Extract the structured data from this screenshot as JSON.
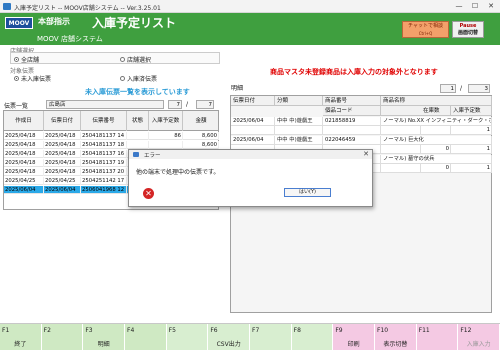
{
  "window": {
    "title": "入庫予定リスト -- MOOV店舗システム -- Ver.3.25.01",
    "min": "—",
    "max": "☐",
    "close": "✕"
  },
  "header": {
    "menu_label": "本部指示",
    "page_title": "入庫予定リスト",
    "logo": "MOOV",
    "system_name": "MOOV 店舗システム",
    "chat_label": "チャットで相談",
    "chat_sub": "Ctrl+Q",
    "pause_label": "Pause",
    "pause_sub": "画面切替"
  },
  "filters": {
    "store_group_label": "店舗選択",
    "store_all": "全店舗",
    "store_select": "店舗選択",
    "target_label": "対象伝票",
    "target_unreceived": "未入庫伝票",
    "target_received": "入庫済伝票"
  },
  "warning_text": "商品マスタ未登録商品は入庫入力の対象外となります",
  "left": {
    "banner": "未入庫伝票一覧を表示しています",
    "panel_label": "伝票一覧",
    "store_name": "広島店",
    "page_current": "7",
    "page_sep": "/",
    "page_total": "7",
    "columns": [
      "作成日",
      "伝票日付",
      "伝票番号",
      "状態",
      "入庫予定数",
      "金額"
    ],
    "rows": [
      [
        "2025/04/18",
        "2025/04/18",
        "2504181137 14",
        "",
        "86",
        "8,600"
      ],
      [
        "2025/04/18",
        "2025/04/18",
        "2504181137 18",
        "",
        "",
        "8,600"
      ],
      [
        "2025/04/18",
        "2025/04/18",
        "2504181137 16",
        "",
        "",
        "8,600"
      ],
      [
        "2025/04/18",
        "2025/04/18",
        "2504181137 19",
        "",
        "",
        "8,600"
      ],
      [
        "2025/04/18",
        "2025/04/18",
        "2504181137 20",
        "",
        "",
        "8,600"
      ],
      [
        "2025/04/25",
        "2025/04/25",
        "2504251142 17",
        "",
        "",
        "8,600"
      ],
      [
        "2025/06/04",
        "2025/06/04",
        "2506041968 12",
        "",
        "",
        "30,000"
      ]
    ]
  },
  "right": {
    "panel_label": "明細",
    "page_current": "1",
    "page_sep": "/",
    "page_total": "3",
    "columns": [
      "伝票日付",
      "分類",
      "商品番号",
      "商品名称"
    ],
    "sub_columns": [
      "個品コード",
      "在庫数",
      "入庫予定数"
    ],
    "rows": [
      {
        "date": "2025/06/04",
        "category": "中中 中)遊戯王",
        "code": "021858819",
        "name": "ノーマル) No.XX インフィニティ・ダーク・ホープ",
        "stock": "",
        "qty": "1"
      },
      {
        "date": "2025/06/04",
        "category": "中中 中)遊戯王",
        "code": "022046459",
        "name": "ノーマル) 巨大化",
        "stock": "0",
        "qty": "1"
      },
      {
        "date": "",
        "category": "",
        "code": "",
        "name": "ノーマル) 墓守の伏兵",
        "stock": "0",
        "qty": "1"
      }
    ]
  },
  "dialog": {
    "title": "エラー",
    "message": "他の端末で処理中の伝票です。",
    "ok_label": "はい(Y)",
    "close": "✕"
  },
  "fkeys": [
    {
      "key": "F1",
      "label": "終了",
      "color": "#cfe9c3"
    },
    {
      "key": "F2",
      "label": "",
      "color": "#cfe9c3"
    },
    {
      "key": "F3",
      "label": "明細",
      "color": "#cfe9c3"
    },
    {
      "key": "F4",
      "label": "",
      "color": "#cfe9c3"
    },
    {
      "key": "F5",
      "label": "",
      "color": "#d8eed0"
    },
    {
      "key": "F6",
      "label": "CSV出力",
      "color": "#d8eed0"
    },
    {
      "key": "F7",
      "label": "",
      "color": "#d8eed0"
    },
    {
      "key": "F8",
      "label": "",
      "color": "#d8eed0"
    },
    {
      "key": "F9",
      "label": "印刷",
      "color": "#f4c9e3"
    },
    {
      "key": "F10",
      "label": "表示切替",
      "color": "#f4c9e3"
    },
    {
      "key": "F11",
      "label": "",
      "color": "#f4c9e3"
    },
    {
      "key": "F12",
      "label": "入庫入力",
      "color": "#f4c9e3"
    }
  ],
  "colors": {
    "header_green": "#3f9f3f",
    "warning_red": "#e00000",
    "banner_blue": "#2a9bd6",
    "selected_row": "#2aa9e8"
  }
}
